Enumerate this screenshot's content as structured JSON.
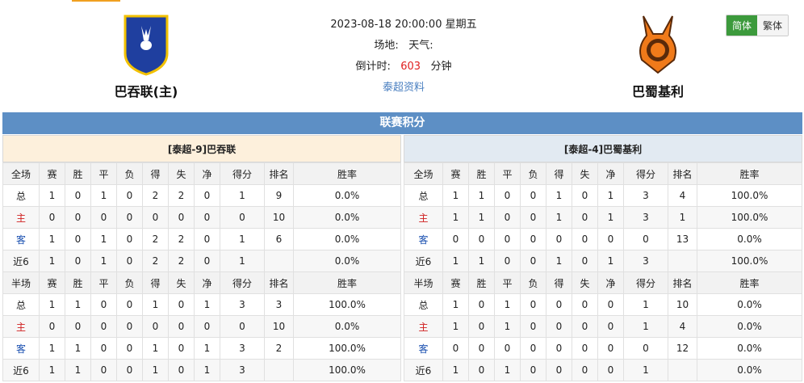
{
  "match": {
    "datetime": "2023-08-18 20:00:00 星期五",
    "venue_label": "场地:",
    "weather_label": "天气:",
    "countdown_label": "倒计时:",
    "countdown_value": "603",
    "countdown_unit": "分钟",
    "league_link": "泰超资料"
  },
  "home_team": {
    "name": "巴吞联(主)"
  },
  "away_team": {
    "name": "巴蜀基利"
  },
  "lang": {
    "simplified": "简体",
    "traditional": "繁体"
  },
  "banner": "联赛积分",
  "left_panel": {
    "title": "[泰超-9]巴吞联",
    "full_header": [
      "全场",
      "赛",
      "胜",
      "平",
      "负",
      "得",
      "失",
      "净",
      "得分",
      "排名",
      "胜率"
    ],
    "full_rows": [
      [
        "总",
        "1",
        "0",
        "1",
        "0",
        "2",
        "2",
        "0",
        "1",
        "9",
        "0.0%"
      ],
      [
        "主",
        "0",
        "0",
        "0",
        "0",
        "0",
        "0",
        "0",
        "0",
        "10",
        "0.0%"
      ],
      [
        "客",
        "1",
        "0",
        "1",
        "0",
        "2",
        "2",
        "0",
        "1",
        "6",
        "0.0%"
      ],
      [
        "近6",
        "1",
        "0",
        "1",
        "0",
        "2",
        "2",
        "0",
        "1",
        "",
        "0.0%"
      ]
    ],
    "half_header": [
      "半场",
      "赛",
      "胜",
      "平",
      "负",
      "得",
      "失",
      "净",
      "得分",
      "排名",
      "胜率"
    ],
    "half_rows": [
      [
        "总",
        "1",
        "1",
        "0",
        "0",
        "1",
        "0",
        "1",
        "3",
        "3",
        "100.0%"
      ],
      [
        "主",
        "0",
        "0",
        "0",
        "0",
        "0",
        "0",
        "0",
        "0",
        "10",
        "0.0%"
      ],
      [
        "客",
        "1",
        "1",
        "0",
        "0",
        "1",
        "0",
        "1",
        "3",
        "2",
        "100.0%"
      ],
      [
        "近6",
        "1",
        "1",
        "0",
        "0",
        "1",
        "0",
        "1",
        "3",
        "",
        "100.0%"
      ]
    ]
  },
  "right_panel": {
    "title": "[泰超-4]巴蜀基利",
    "full_header": [
      "全场",
      "赛",
      "胜",
      "平",
      "负",
      "得",
      "失",
      "净",
      "得分",
      "排名",
      "胜率"
    ],
    "full_rows": [
      [
        "总",
        "1",
        "1",
        "0",
        "0",
        "1",
        "0",
        "1",
        "3",
        "4",
        "100.0%"
      ],
      [
        "主",
        "1",
        "1",
        "0",
        "0",
        "1",
        "0",
        "1",
        "3",
        "1",
        "100.0%"
      ],
      [
        "客",
        "0",
        "0",
        "0",
        "0",
        "0",
        "0",
        "0",
        "0",
        "13",
        "0.0%"
      ],
      [
        "近6",
        "1",
        "1",
        "0",
        "0",
        "1",
        "0",
        "1",
        "3",
        "",
        "100.0%"
      ]
    ],
    "half_header": [
      "半场",
      "赛",
      "胜",
      "平",
      "负",
      "得",
      "失",
      "净",
      "得分",
      "排名",
      "胜率"
    ],
    "half_rows": [
      [
        "总",
        "1",
        "0",
        "1",
        "0",
        "0",
        "0",
        "0",
        "1",
        "10",
        "0.0%"
      ],
      [
        "主",
        "1",
        "0",
        "1",
        "0",
        "0",
        "0",
        "0",
        "1",
        "4",
        "0.0%"
      ],
      [
        "客",
        "0",
        "0",
        "0",
        "0",
        "0",
        "0",
        "0",
        "0",
        "12",
        "0.0%"
      ],
      [
        "近6",
        "1",
        "0",
        "1",
        "0",
        "0",
        "0",
        "0",
        "1",
        "",
        "0.0%"
      ]
    ]
  }
}
